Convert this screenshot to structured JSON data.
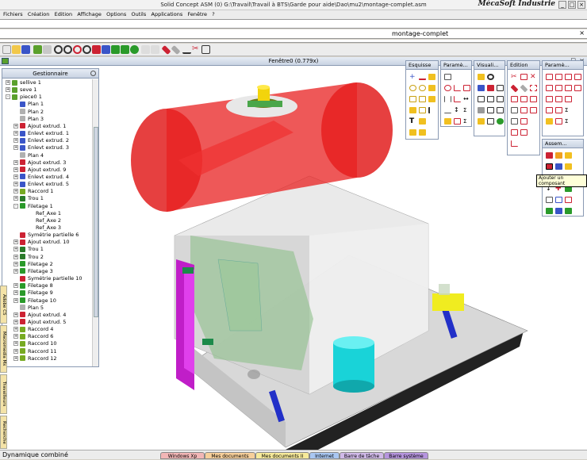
{
  "window": {
    "title": "Solid Concept ASM (0) G:\\Travail\\Travail à BTS\\Garde pour aide\\Dao\\mu2\\montage-complet.asm",
    "app_name": "MécaSoft Industrie"
  },
  "menu": [
    "Fichiers",
    "Création",
    "Edition",
    "Affichage",
    "Options",
    "Outils",
    "Applications",
    "Fenêtre",
    "?"
  ],
  "document_tab": "montage-complet",
  "viewport_title": "Fenêtre0 (0.779x)",
  "manager": {
    "title": "Gestionnaire",
    "items": [
      {
        "label": "sellive 1",
        "level": 0,
        "exp": "+",
        "icon": "part-icon",
        "color": "#5aa02c"
      },
      {
        "label": "seve 1",
        "level": 0,
        "exp": "+",
        "icon": "part-icon",
        "color": "#5aa02c"
      },
      {
        "label": "piece0 1",
        "level": 0,
        "exp": "-",
        "icon": "part-icon",
        "color": "#5aa02c"
      },
      {
        "label": "Plan 1",
        "level": 1,
        "exp": "",
        "icon": "plane-icon",
        "color": "#3a55c8"
      },
      {
        "label": "Plan 2",
        "level": 1,
        "exp": "",
        "icon": "plane-icon",
        "color": "#b0b0b0"
      },
      {
        "label": "Plan 3",
        "level": 1,
        "exp": "",
        "icon": "plane-icon",
        "color": "#b0b0b0"
      },
      {
        "label": "Ajout extrud. 1",
        "level": 1,
        "exp": "+",
        "icon": "extrude-icon",
        "color": "#c23"
      },
      {
        "label": "Enlevt extrud. 1",
        "level": 1,
        "exp": "+",
        "icon": "cut-icon",
        "color": "#3a55c8"
      },
      {
        "label": "Enlevt extrud. 2",
        "level": 1,
        "exp": "+",
        "icon": "cut-icon",
        "color": "#3a55c8"
      },
      {
        "label": "Enlevt extrud. 3",
        "level": 1,
        "exp": "+",
        "icon": "cut-icon",
        "color": "#3a55c8"
      },
      {
        "label": "Plan 4",
        "level": 1,
        "exp": "",
        "icon": "plane-icon",
        "color": "#b0b0b0"
      },
      {
        "label": "Ajout extrud. 3",
        "level": 1,
        "exp": "+",
        "icon": "extrude-icon",
        "color": "#c23"
      },
      {
        "label": "Ajout extrud. 9",
        "level": 1,
        "exp": "+",
        "icon": "extrude-icon",
        "color": "#c23"
      },
      {
        "label": "Enlevt extrud. 4",
        "level": 1,
        "exp": "+",
        "icon": "cut-icon",
        "color": "#3a55c8"
      },
      {
        "label": "Enlevt extrud. 5",
        "level": 1,
        "exp": "+",
        "icon": "cut-icon",
        "color": "#3a55c8"
      },
      {
        "label": "Raccord 1",
        "level": 1,
        "exp": "+",
        "icon": "fillet-icon",
        "color": "#7a2"
      },
      {
        "label": "Trou 1",
        "level": 1,
        "exp": "+",
        "icon": "hole-icon",
        "color": "#2a7a2a"
      },
      {
        "label": "Filetage 1",
        "level": 1,
        "exp": "-",
        "icon": "thread-icon",
        "color": "#2a9a2a"
      },
      {
        "label": "Ref_Axe 1",
        "level": 2,
        "exp": "",
        "icon": "axis-icon",
        "color": "#ffffff"
      },
      {
        "label": "Ref_Axe 2",
        "level": 2,
        "exp": "",
        "icon": "axis-icon",
        "color": "#ffffff"
      },
      {
        "label": "Ref_Axe 3",
        "level": 2,
        "exp": "",
        "icon": "axis-icon",
        "color": "#ffffff"
      },
      {
        "label": "Symétrie partielle 6",
        "level": 1,
        "exp": "",
        "icon": "symmetry-icon",
        "color": "#c23"
      },
      {
        "label": "Ajout extrud. 10",
        "level": 1,
        "exp": "+",
        "icon": "extrude-icon",
        "color": "#c23"
      },
      {
        "label": "Trou 1",
        "level": 1,
        "exp": "+",
        "icon": "hole-icon",
        "color": "#2a7a2a"
      },
      {
        "label": "Trou 2",
        "level": 1,
        "exp": "+",
        "icon": "hole-icon",
        "color": "#2a7a2a"
      },
      {
        "label": "Filetage 2",
        "level": 1,
        "exp": "+",
        "icon": "thread-icon",
        "color": "#2a9a2a"
      },
      {
        "label": "Filetage 3",
        "level": 1,
        "exp": "+",
        "icon": "thread-icon",
        "color": "#2a9a2a"
      },
      {
        "label": "Symétrie partielle 10",
        "level": 1,
        "exp": "",
        "icon": "symmetry-icon",
        "color": "#c23"
      },
      {
        "label": "Filetage 8",
        "level": 1,
        "exp": "+",
        "icon": "thread-icon",
        "color": "#2a9a2a"
      },
      {
        "label": "Filetage 9",
        "level": 1,
        "exp": "+",
        "icon": "thread-icon",
        "color": "#2a9a2a"
      },
      {
        "label": "Filetage 10",
        "level": 1,
        "exp": "+",
        "icon": "thread-icon",
        "color": "#2a9a2a"
      },
      {
        "label": "Plan 5",
        "level": 1,
        "exp": "",
        "icon": "plane-icon",
        "color": "#b0b0b0"
      },
      {
        "label": "Ajout extrud. 4",
        "level": 1,
        "exp": "+",
        "icon": "extrude-icon",
        "color": "#c23"
      },
      {
        "label": "Ajout extrud. 5",
        "level": 1,
        "exp": "+",
        "icon": "extrude-icon",
        "color": "#c23"
      },
      {
        "label": "Raccord 4",
        "level": 1,
        "exp": "+",
        "icon": "fillet-icon",
        "color": "#7a2"
      },
      {
        "label": "Raccord 6",
        "level": 1,
        "exp": "+",
        "icon": "fillet-icon",
        "color": "#7a2"
      },
      {
        "label": "Raccord 10",
        "level": 1,
        "exp": "+",
        "icon": "fillet-icon",
        "color": "#7a2"
      },
      {
        "label": "Raccord 11",
        "level": 1,
        "exp": "+",
        "icon": "fillet-icon",
        "color": "#7a2"
      },
      {
        "label": "Raccord 12",
        "level": 1,
        "exp": "+",
        "icon": "fillet-icon",
        "color": "#7a2"
      }
    ]
  },
  "palettes": {
    "esquisse": "Esquisse",
    "parametres1": "Paramè...",
    "visualisation": "Visuali...",
    "edition": "Edition",
    "parametres2": "Paramè...",
    "assemblage": "Assem..."
  },
  "tooltip": "Ajouter un composant",
  "side_tabs": [
    "Adobe CS",
    "Macromedia Mx",
    "Travailleurs",
    "Recherche"
  ],
  "status_text": "Dynamique combiné",
  "taskbar_tabs": [
    {
      "label": "Windows Xp",
      "color": "#f2b6b6"
    },
    {
      "label": "Mes documents",
      "color": "#f7cf9a"
    },
    {
      "label": "Mes documents II",
      "color": "#f7ea9a"
    },
    {
      "label": "Internet",
      "color": "#a9c7f2"
    },
    {
      "label": "Barre de tâche",
      "color": "#d0b9e8"
    },
    {
      "label": "Barre système",
      "color": "#b695de"
    }
  ]
}
